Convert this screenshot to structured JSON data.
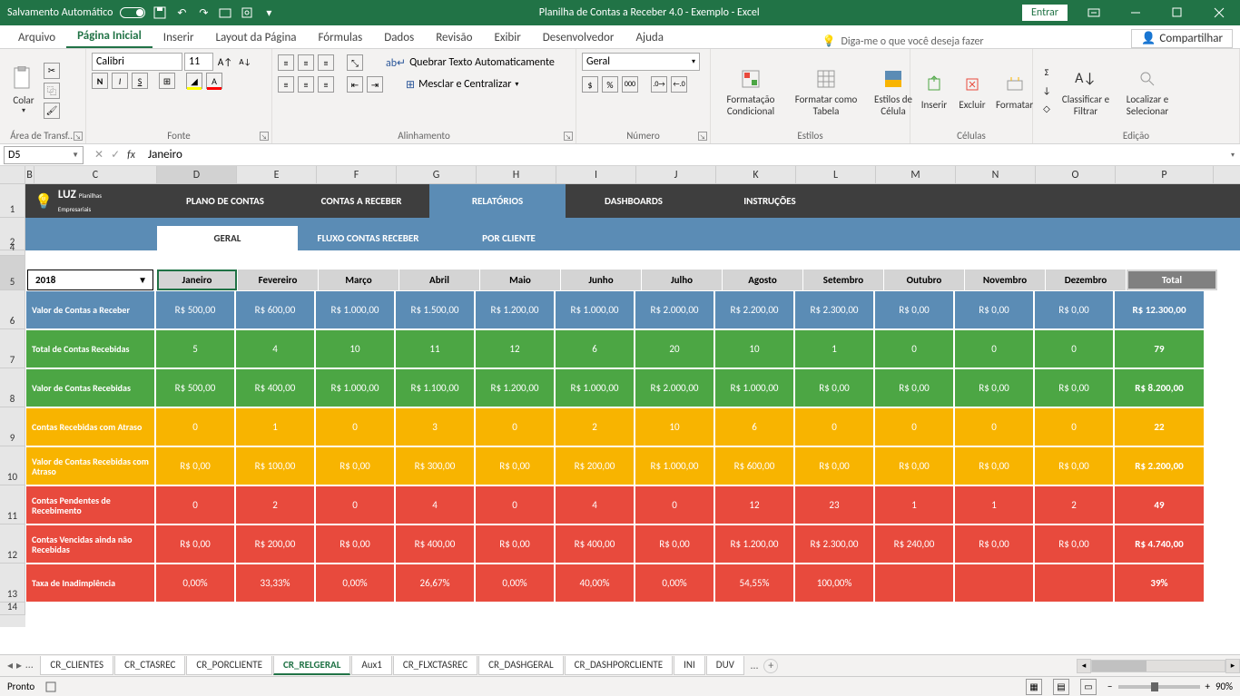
{
  "title": "Planilha de Contas a Receber 4.0 - Exemplo  -  Excel",
  "autosave": "Salvamento Automático",
  "signin": "Entrar",
  "tabs": [
    "Arquivo",
    "Página Inicial",
    "Inserir",
    "Layout da Página",
    "Fórmulas",
    "Dados",
    "Revisão",
    "Exibir",
    "Desenvolvedor",
    "Ajuda"
  ],
  "tellme": "Diga-me o que você deseja fazer",
  "share": "Compartilhar",
  "clipboard": {
    "paste": "Colar",
    "group": "Área de Transf..."
  },
  "font": {
    "name": "Calibri",
    "size": "11",
    "group": "Fonte"
  },
  "align": {
    "wrap": "Quebrar Texto Automaticamente",
    "merge": "Mesclar e Centralizar",
    "group": "Alinhamento"
  },
  "number": {
    "format": "Geral",
    "group": "Número"
  },
  "styles": {
    "cond": "Formatação Condicional",
    "table": "Formatar como Tabela",
    "cell": "Estilos de Célula",
    "group": "Estilos"
  },
  "cells": {
    "insert": "Inserir",
    "delete": "Excluir",
    "format": "Formatar",
    "group": "Células"
  },
  "editing": {
    "sort": "Classificar e Filtrar",
    "find": "Localizar e Selecionar",
    "group": "Edição"
  },
  "namebox": "D5",
  "formula": "Janeiro",
  "cols": [
    "B",
    "C",
    "D",
    "E",
    "F",
    "G",
    "H",
    "I",
    "J",
    "K",
    "L",
    "M",
    "N",
    "O",
    "P"
  ],
  "rowNums": [
    "1",
    "2",
    "4",
    "5",
    "6",
    "7",
    "8",
    "9",
    "10",
    "11",
    "12",
    "13",
    "14"
  ],
  "logo": {
    "main": "LUZ",
    "sub1": "Planilhas",
    "sub2": "Empresariais"
  },
  "nav1": [
    "PLANO DE CONTAS",
    "CONTAS A RECEBER",
    "RELATÓRIOS",
    "DASHBOARDS",
    "INSTRUÇÕES"
  ],
  "nav2": [
    "GERAL",
    "FLUXO CONTAS RECEBER",
    "POR CLIENTE"
  ],
  "year": "2018",
  "months": [
    "Janeiro",
    "Fevereiro",
    "Março",
    "Abril",
    "Maio",
    "Junho",
    "Julho",
    "Agosto",
    "Setembro",
    "Outubro",
    "Novembro",
    "Dezembro",
    "Total"
  ],
  "rows": [
    {
      "label": "Valor de Contas a Receber",
      "cls": "c-blue",
      "vals": [
        "R$ 500,00",
        "R$ 600,00",
        "R$ 1.000,00",
        "R$ 1.500,00",
        "R$ 1.200,00",
        "R$ 1.000,00",
        "R$ 2.000,00",
        "R$ 2.200,00",
        "R$ 2.300,00",
        "R$ 0,00",
        "R$ 0,00",
        "R$ 0,00",
        "R$ 12.300,00"
      ]
    },
    {
      "label": "Total de Contas Recebidas",
      "cls": "c-green",
      "vals": [
        "5",
        "4",
        "10",
        "11",
        "12",
        "6",
        "20",
        "10",
        "1",
        "0",
        "0",
        "0",
        "79"
      ]
    },
    {
      "label": "Valor de Contas Recebidas",
      "cls": "c-green",
      "vals": [
        "R$ 500,00",
        "R$ 400,00",
        "R$ 1.000,00",
        "R$ 1.100,00",
        "R$ 1.200,00",
        "R$ 1.000,00",
        "R$ 2.000,00",
        "R$ 1.000,00",
        "R$ 0,00",
        "R$ 0,00",
        "R$ 0,00",
        "R$ 0,00",
        "R$ 8.200,00"
      ]
    },
    {
      "label": "Contas Recebidas com Atraso",
      "cls": "c-yellow",
      "vals": [
        "0",
        "1",
        "0",
        "3",
        "0",
        "2",
        "10",
        "6",
        "0",
        "0",
        "0",
        "0",
        "22"
      ]
    },
    {
      "label": "Valor de Contas Recebidas com Atraso",
      "cls": "c-yellow",
      "vals": [
        "R$ 0,00",
        "R$ 100,00",
        "R$ 0,00",
        "R$ 300,00",
        "R$ 0,00",
        "R$ 200,00",
        "R$ 1.000,00",
        "R$ 600,00",
        "R$ 0,00",
        "R$ 0,00",
        "R$ 0,00",
        "R$ 0,00",
        "R$ 2.200,00"
      ]
    },
    {
      "label": "Contas Pendentes de Recebimento",
      "cls": "c-red",
      "vals": [
        "0",
        "2",
        "0",
        "4",
        "0",
        "4",
        "0",
        "12",
        "23",
        "1",
        "1",
        "2",
        "49"
      ]
    },
    {
      "label": "Contas Vencidas ainda não Recebidas",
      "cls": "c-red",
      "vals": [
        "R$ 0,00",
        "R$ 200,00",
        "R$ 0,00",
        "R$ 400,00",
        "R$ 0,00",
        "R$ 400,00",
        "R$ 0,00",
        "R$ 1.200,00",
        "R$ 2.300,00",
        "R$ 240,00",
        "R$ 0,00",
        "R$ 0,00",
        "R$ 4.740,00"
      ]
    },
    {
      "label": "Taxa de Inadimplência",
      "cls": "c-red",
      "vals": [
        "0,00%",
        "33,33%",
        "0,00%",
        "26,67%",
        "0,00%",
        "40,00%",
        "0,00%",
        "54,55%",
        "100,00%",
        "",
        "",
        "",
        "39%"
      ]
    }
  ],
  "sheetTabs": [
    "CR_CLIENTES",
    "CR_CTASREC",
    "CR_PORCLIENTE",
    "CR_RELGERAL",
    "Aux1",
    "CR_FLXCTASREC",
    "CR_DASHGERAL",
    "CR_DASHPORCLIENTE",
    "INI",
    "DUV"
  ],
  "activeSheet": 3,
  "statusReady": "Pronto",
  "zoom": "90%"
}
